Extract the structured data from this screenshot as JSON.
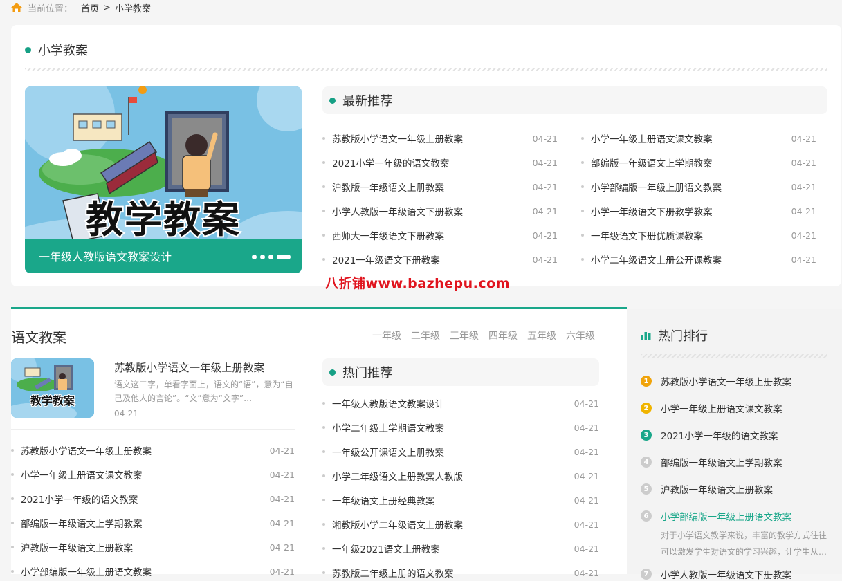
{
  "breadcrumb": {
    "label": "当前位置：",
    "home": "首页",
    "sep": ">",
    "current": "小学教案"
  },
  "colors": {
    "accent": "#1aa78a",
    "rank1": "#f0a30a",
    "rank2": "#f0b400",
    "rank3": "#1aa78a",
    "rank_other": "#cccccc",
    "watermark": "#e0141e"
  },
  "top": {
    "title": "小学教案",
    "banner": {
      "art_text": "教学教案",
      "caption": "一年级人教版语文教案设计"
    },
    "recommend": {
      "title": "最新推荐",
      "left": [
        {
          "title": "苏教版小学语文一年级上册教案",
          "date": "04-21"
        },
        {
          "title": "2021小学一年级的语文教案",
          "date": "04-21"
        },
        {
          "title": "沪教版一年级语文上册教案",
          "date": "04-21"
        },
        {
          "title": "小学人教版一年级语文下册教案",
          "date": "04-21"
        },
        {
          "title": "西师大一年级语文下册教案",
          "date": "04-21"
        },
        {
          "title": "2021一年级语文下册教案",
          "date": "04-21"
        }
      ],
      "right": [
        {
          "title": "小学一年级上册语文课文教案",
          "date": "04-21"
        },
        {
          "title": "部编版一年级语文上学期教案",
          "date": "04-21"
        },
        {
          "title": "小学部编版一年级上册语文教案",
          "date": "04-21"
        },
        {
          "title": "小学一年级语文下册教学教案",
          "date": "04-21"
        },
        {
          "title": "一年级语文下册优质课教案",
          "date": "04-21"
        },
        {
          "title": "小学二年级语文上册公开课教案",
          "date": "04-21"
        }
      ]
    }
  },
  "watermark": "八折铺www.bazhepu.com",
  "yuwen": {
    "title": "语文教案",
    "grades": [
      "一年级",
      "二年级",
      "三年级",
      "四年级",
      "五年级",
      "六年级"
    ],
    "featured": {
      "art_text": "教学教案",
      "title": "苏教版小学语文一年级上册教案",
      "desc": "语文这二字，单看字面上，语文的“语”，意为“自己及他人的言论”。“文”意为“文字”…",
      "date": "04-21"
    },
    "list": [
      {
        "title": "苏教版小学语文一年级上册教案",
        "date": "04-21"
      },
      {
        "title": "小学一年级上册语文课文教案",
        "date": "04-21"
      },
      {
        "title": "2021小学一年级的语文教案",
        "date": "04-21"
      },
      {
        "title": "部编版一年级语文上学期教案",
        "date": "04-21"
      },
      {
        "title": "沪教版一年级语文上册教案",
        "date": "04-21"
      },
      {
        "title": "小学部编版一年级上册语文教案",
        "date": "04-21"
      }
    ],
    "hot": {
      "title": "热门推荐",
      "list": [
        {
          "title": "一年级人教版语文教案设计",
          "date": "04-21"
        },
        {
          "title": "小学二年级上学期语文教案",
          "date": "04-21"
        },
        {
          "title": "一年级公开课语文上册教案",
          "date": "04-21"
        },
        {
          "title": "小学二年级语文上册教案人教版",
          "date": "04-21"
        },
        {
          "title": "一年级语文上册经典教案",
          "date": "04-21"
        },
        {
          "title": "湘教版小学二年级语文上册教案",
          "date": "04-21"
        },
        {
          "title": "一年级2021语文上册教案",
          "date": "04-21"
        },
        {
          "title": "苏教版二年级上册的语文教案",
          "date": "04-21"
        }
      ]
    }
  },
  "ranking": {
    "title": "热门排行",
    "items": [
      {
        "num": "1",
        "title": "苏教版小学语文一年级上册教案"
      },
      {
        "num": "2",
        "title": "小学一年级上册语文课文教案"
      },
      {
        "num": "3",
        "title": "2021小学一年级的语文教案"
      },
      {
        "num": "4",
        "title": "部编版一年级语文上学期教案"
      },
      {
        "num": "5",
        "title": "沪教版一年级语文上册教案"
      },
      {
        "num": "6",
        "title": "小学部编版一年级上册语文教案"
      },
      {
        "num": "7",
        "title": "小学人教版一年级语文下册教案"
      }
    ],
    "active_desc": "对于小学语文教学来说，丰富的教学方式往往可以激发学生对语文的学习兴趣，让学生从…"
  }
}
